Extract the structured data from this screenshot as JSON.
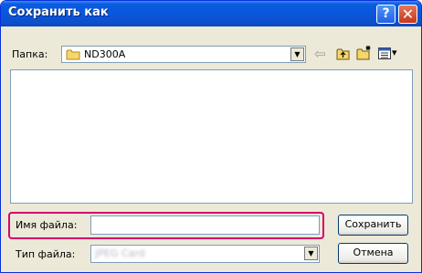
{
  "window": {
    "title": "Сохранить как",
    "help_glyph": "?",
    "close_glyph": "✕"
  },
  "folder": {
    "label": "Папка:",
    "value": "ND300A",
    "arrow": "▼"
  },
  "toolbar": {
    "back": "⇦",
    "view_arrow": "▾"
  },
  "filename": {
    "label": "Имя файла:",
    "value": ""
  },
  "filetype": {
    "label": "Тип файла:",
    "value": "JPEG Card",
    "arrow": "▼"
  },
  "buttons": {
    "save": "Сохранить",
    "cancel": "Отмена"
  },
  "colors": {
    "highlight": "#d6006f",
    "titlebar": "#0a55db"
  }
}
